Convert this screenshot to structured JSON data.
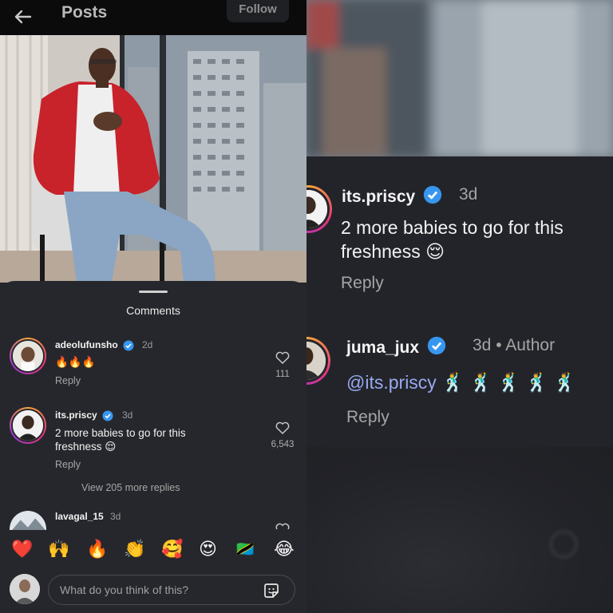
{
  "colors": {
    "background": "#26272c",
    "accent_mention": "#98a9f0",
    "verified": "#3797f0",
    "heart_red": "#e53935"
  },
  "left": {
    "topbar": {
      "title": "Posts",
      "follow_label": "Follow",
      "back_icon": "back-arrow-icon"
    },
    "comments_sheet": {
      "title": "Comments",
      "comments": [
        {
          "username": "adeolufunsho",
          "time": "2d",
          "text": "🔥🔥🔥",
          "reply_label": "Reply",
          "likes": "111"
        },
        {
          "username": "its.priscy",
          "time": "3d",
          "text_line1": "2 more babies to go for this",
          "text_line2": "freshness 😌",
          "reply_label": "Reply",
          "likes": "6,543"
        },
        {
          "username": "lavagal_15",
          "time": "3d"
        }
      ],
      "view_more": "View 205 more replies",
      "reactions": [
        "❤️",
        "🙌",
        "🔥",
        "👏",
        "🥰",
        "😍",
        "🇹🇿",
        "😂"
      ],
      "composer": {
        "placeholder": "What do you think of this?",
        "sticker_icon": "sticker-icon"
      }
    }
  },
  "right": {
    "comments": [
      {
        "username": "its.priscy",
        "time": "3d",
        "text_line1": "2 more babies to go for this",
        "text_line2": "freshness 😌",
        "reply_label": "Reply"
      },
      {
        "username": "juma_jux",
        "time": "3d",
        "author_tag": "• Author",
        "mention": "@its.priscy",
        "emojis": " 🕺 🕺 🕺 🕺 🕺",
        "reply_label": "Reply"
      }
    ]
  }
}
